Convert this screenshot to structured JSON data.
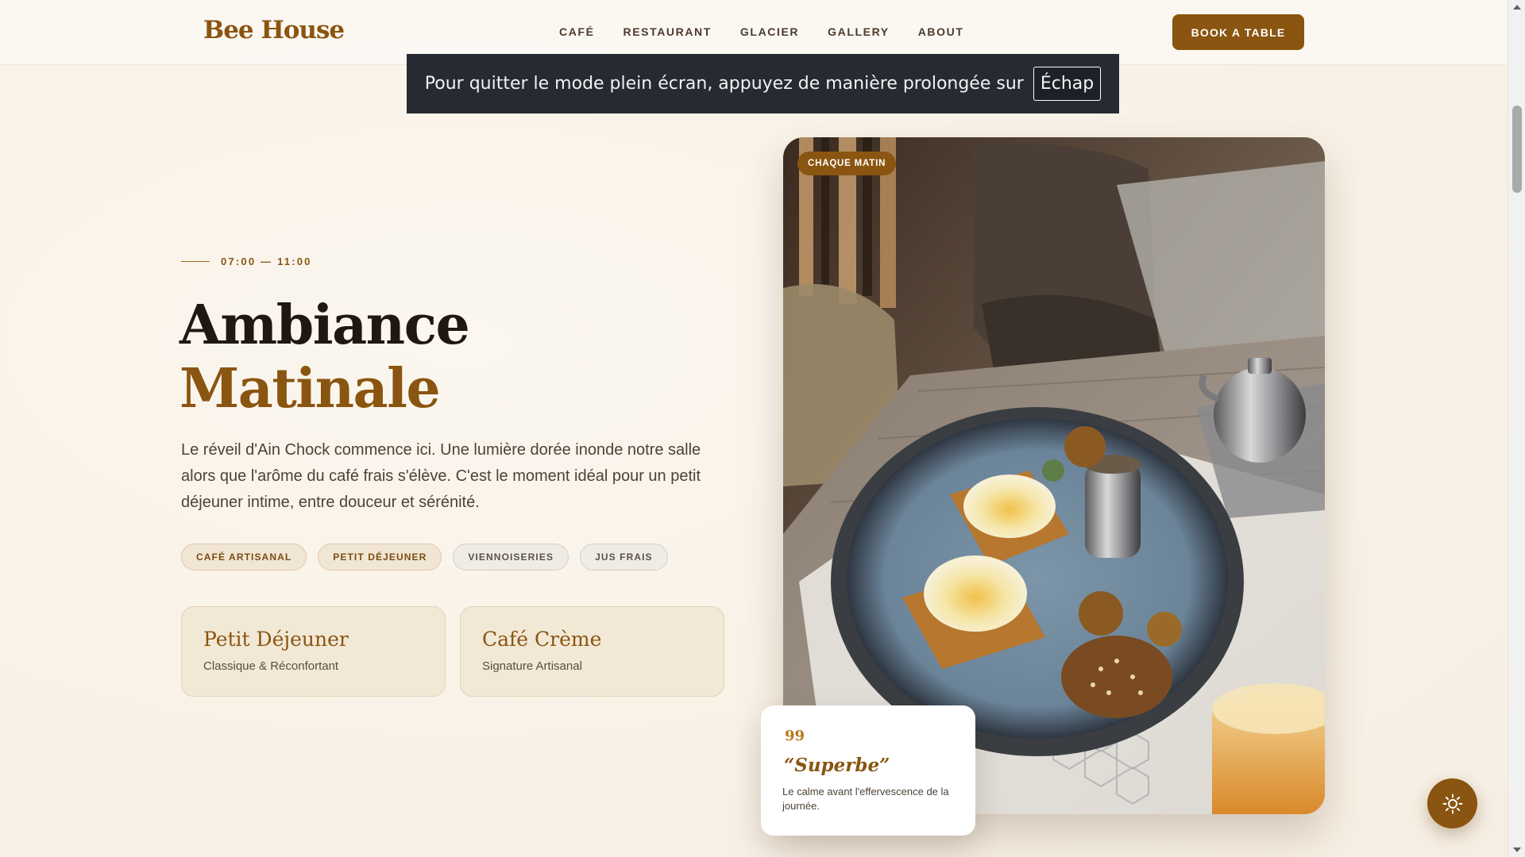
{
  "header": {
    "logo": "Bee House",
    "nav": [
      "CAFÉ",
      "RESTAURANT",
      "GLACIER",
      "GALLERY",
      "ABOUT"
    ],
    "cta": "BOOK A TABLE"
  },
  "toast": {
    "message": "Pour quitter le mode plein écran, appuyez de manière prolongée sur",
    "key": "Échap"
  },
  "hero": {
    "hours": "07:00 — 11:00",
    "title_line1": "Ambiance",
    "title_line2": "Matinale",
    "description": "Le réveil d'Ain Chock commence ici. Une lumière dorée inonde notre salle alors que l'arôme du café frais s'élève. C'est le moment idéal pour un petit déjeuner intime, entre douceur et sérénité.",
    "tags": [
      "CAFÉ ARTISANAL",
      "PETIT DÉJEUNER",
      "VIENNOISERIES",
      "JUS FRAIS"
    ],
    "cards": [
      {
        "title": "Petit Déjeuner",
        "subtitle": "Classique & Réconfortant"
      },
      {
        "title": "Café Crème",
        "subtitle": "Signature Artisanal"
      }
    ]
  },
  "photo": {
    "badge": "CHAQUE MATIN"
  },
  "quote": {
    "mark": "99",
    "title": "“Superbe”",
    "text": "Le calme avant l'effervescence de la journée."
  },
  "colors": {
    "brand": "#8a5510",
    "background": "#f8f1e6",
    "toast_bg": "#262a33"
  },
  "icons": {
    "theme_toggle": "sun-icon"
  }
}
